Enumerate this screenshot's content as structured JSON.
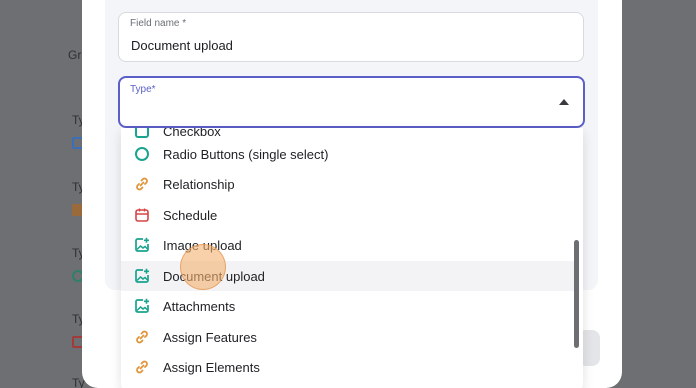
{
  "background": {
    "frag_gr": "Gr",
    "frag_ty1": "Ty",
    "frag_ty2": "Ty",
    "frag_ty3": "Ty",
    "frag_ty4": "Ty",
    "frag_ty5": "Ty"
  },
  "form": {
    "field_name_label": "Field name *",
    "field_name_value": "Document upload",
    "type_label": "Type*"
  },
  "dropdown": {
    "options": [
      {
        "label": "Checkbox",
        "icon": "checkbox-icon"
      },
      {
        "label": "Radio Buttons (single select)",
        "icon": "radio-circle-icon"
      },
      {
        "label": "Relationship",
        "icon": "link-icon"
      },
      {
        "label": "Schedule",
        "icon": "calendar-icon"
      },
      {
        "label": "Image upload",
        "icon": "image-plus-icon"
      },
      {
        "label": "Document upload",
        "icon": "image-plus-icon"
      },
      {
        "label": "Attachments",
        "icon": "image-plus-icon"
      },
      {
        "label": "Assign Features",
        "icon": "link-icon"
      },
      {
        "label": "Assign Elements",
        "icon": "link-icon"
      }
    ],
    "hovered": "Document upload"
  },
  "colors": {
    "accent": "#5b5fc7",
    "teal": "#1aa38f",
    "orange": "#e0953a",
    "red": "#d64545"
  }
}
